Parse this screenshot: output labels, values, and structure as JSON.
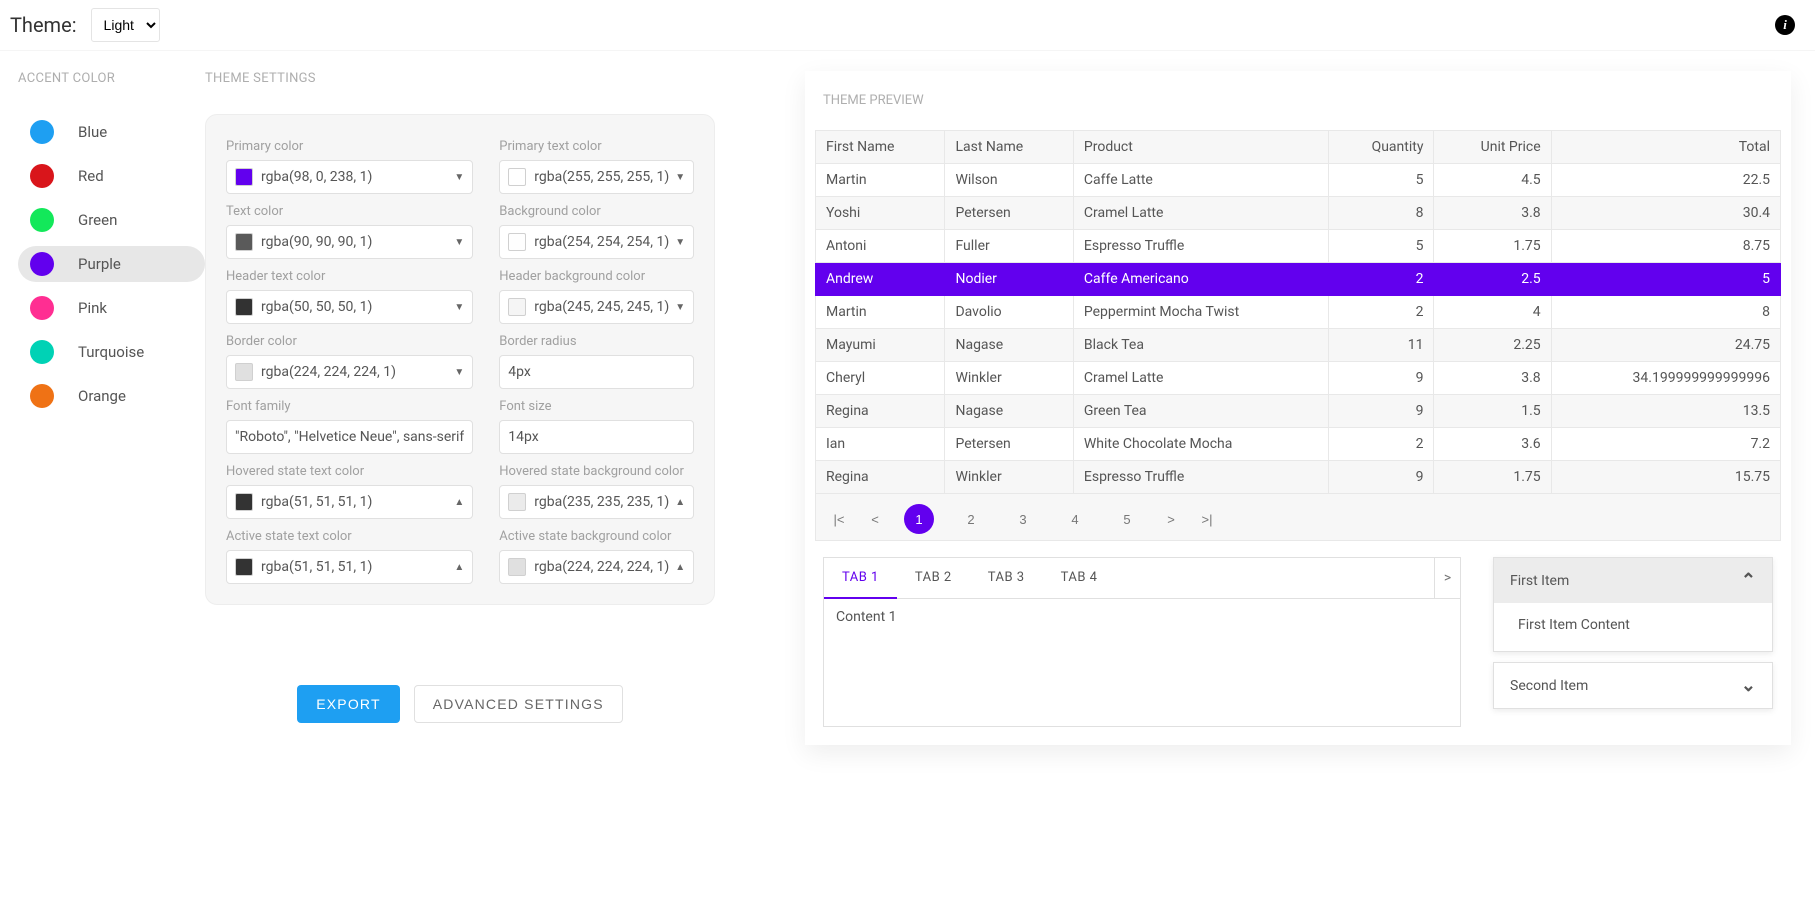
{
  "topbar": {
    "theme_label": "Theme:",
    "theme_value": "Light"
  },
  "colors": {
    "blue": "#1e9ff2",
    "red": "#d9151b",
    "green": "#13e85a",
    "purple": "#6200ee",
    "pink": "#ff2e92",
    "turquoise": "#00d2b5",
    "orange": "#ef7215"
  },
  "accent": {
    "title": "Accent Color",
    "selected": "Purple",
    "items": [
      {
        "label": "Blue",
        "color_key": "blue"
      },
      {
        "label": "Red",
        "color_key": "red"
      },
      {
        "label": "Green",
        "color_key": "green"
      },
      {
        "label": "Purple",
        "color_key": "purple"
      },
      {
        "label": "Pink",
        "color_key": "pink"
      },
      {
        "label": "Turquoise",
        "color_key": "turquoise"
      },
      {
        "label": "Orange",
        "color_key": "orange"
      }
    ]
  },
  "settings": {
    "title": "Theme Settings",
    "fields": {
      "primary_color": {
        "label": "Primary color",
        "value": "rgba(98, 0, 238, 1)",
        "swatch": "#6200ee",
        "caret": "down"
      },
      "primary_text_color": {
        "label": "Primary text color",
        "value": "rgba(255, 255, 255, 1)",
        "swatch": "#ffffff",
        "caret": "down"
      },
      "text_color": {
        "label": "Text color",
        "value": "rgba(90, 90, 90, 1)",
        "swatch": "#5a5a5a",
        "caret": "down"
      },
      "background_color": {
        "label": "Background color",
        "value": "rgba(254, 254, 254, 1)",
        "swatch": "#fefefe",
        "caret": "down"
      },
      "header_text_color": {
        "label": "Header text color",
        "value": "rgba(50, 50, 50, 1)",
        "swatch": "#323232",
        "caret": "down"
      },
      "header_background_color": {
        "label": "Header background color",
        "value": "rgba(245, 245, 245, 1)",
        "swatch": "#f5f5f5",
        "caret": "down"
      },
      "border_color": {
        "label": "Border color",
        "value": "rgba(224, 224, 224, 1)",
        "swatch": "#e0e0e0",
        "caret": "down"
      },
      "border_radius": {
        "label": "Border radius",
        "value": "4px"
      },
      "font_family": {
        "label": "Font family",
        "value": "\"Roboto\", \"Helvetice Neue\", sans-serif"
      },
      "font_size": {
        "label": "Font size",
        "value": "14px"
      },
      "hovered_text": {
        "label": "Hovered state text color",
        "value": "rgba(51, 51, 51, 1)",
        "swatch": "#333333",
        "caret": "up"
      },
      "hovered_bg": {
        "label": "Hovered state background color",
        "value": "rgba(235, 235, 235, 1)",
        "swatch": "#ebebeb",
        "caret": "up"
      },
      "active_text": {
        "label": "Active state text color",
        "value": "rgba(51, 51, 51, 1)",
        "swatch": "#333333",
        "caret": "up"
      },
      "active_bg": {
        "label": "Active state background color",
        "value": "rgba(224, 224, 224, 1)",
        "swatch": "#e0e0e0",
        "caret": "up"
      }
    }
  },
  "buttons": {
    "export": "EXPORT",
    "advanced": "ADVANCED SETTINGS"
  },
  "preview": {
    "title": "Theme Preview",
    "table": {
      "columns": [
        "First Name",
        "Last Name",
        "Product",
        "Quantity",
        "Unit Price",
        "Total"
      ],
      "numeric_cols": [
        3,
        4,
        5
      ],
      "selected_row": 3,
      "rows": [
        [
          "Martin",
          "Wilson",
          "Caffe Latte",
          "5",
          "4.5",
          "22.5"
        ],
        [
          "Yoshi",
          "Petersen",
          "Cramel Latte",
          "8",
          "3.8",
          "30.4"
        ],
        [
          "Antoni",
          "Fuller",
          "Espresso Truffle",
          "5",
          "1.75",
          "8.75"
        ],
        [
          "Andrew",
          "Nodier",
          "Caffe Americano",
          "2",
          "2.5",
          "5"
        ],
        [
          "Martin",
          "Davolio",
          "Peppermint Mocha Twist",
          "2",
          "4",
          "8"
        ],
        [
          "Mayumi",
          "Nagase",
          "Black Tea",
          "11",
          "2.25",
          "24.75"
        ],
        [
          "Cheryl",
          "Winkler",
          "Cramel Latte",
          "9",
          "3.8",
          "34.199999999999996"
        ],
        [
          "Regina",
          "Nagase",
          "Green Tea",
          "9",
          "1.5",
          "13.5"
        ],
        [
          "Ian",
          "Petersen",
          "White Chocolate Mocha",
          "2",
          "3.6",
          "7.2"
        ],
        [
          "Regina",
          "Winkler",
          "Espresso Truffle",
          "9",
          "1.75",
          "15.75"
        ]
      ]
    },
    "pager": {
      "labels": {
        "first": "|<",
        "prev": "<",
        "next": ">",
        "last": ">|"
      },
      "pages": [
        "1",
        "2",
        "3",
        "4",
        "5"
      ],
      "active": "1"
    },
    "tabs": {
      "items": [
        "TAB 1",
        "TAB 2",
        "TAB 3",
        "TAB 4"
      ],
      "active": 0,
      "content": "Content 1",
      "scroll_hint": ">"
    },
    "accordion": {
      "items": [
        {
          "label": "First Item",
          "open": true,
          "content": "First Item Content"
        },
        {
          "label": "Second Item",
          "open": false
        }
      ]
    }
  }
}
